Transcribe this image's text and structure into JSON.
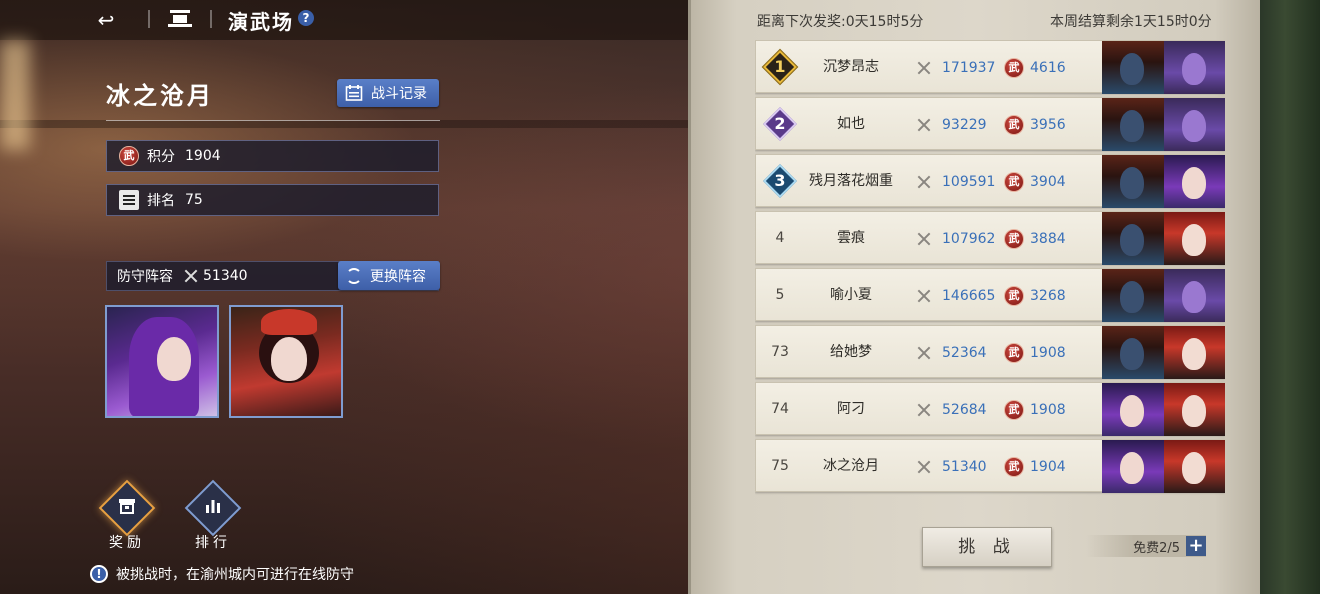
{
  "header": {
    "back_icon": "back-arrow-icon",
    "home_icon": "home-icon",
    "title": "演武场",
    "help_icon": "question-icon",
    "help_glyph": "?"
  },
  "player": {
    "name": "冰之沧月",
    "battle_log_label": "战斗记录",
    "score_label": "积分",
    "score": "1904",
    "rank_label": "排名",
    "rank": "75",
    "defense_label": "防守阵容",
    "defense_power": "51340",
    "change_lineup_label": "更换阵容"
  },
  "side_buttons": {
    "reward_label": "奖励",
    "ranking_label": "排行"
  },
  "tip": {
    "glyph": "!",
    "text": "被挑战时，在渝州城内可进行在线防守"
  },
  "ranking": {
    "reward_timer": "距离下次发奖:0天15时5分",
    "settle_timer": "本周结算剩余1天15时0分",
    "score_badge_glyph": "武",
    "rows": [
      {
        "rank": "1",
        "name": "沉梦昂志",
        "power": "171937",
        "score": "4616",
        "team": [
          "masked",
          "purple-demon"
        ]
      },
      {
        "rank": "2",
        "name": "如也",
        "power": "93229",
        "score": "3956",
        "team": [
          "masked",
          "purple-demon"
        ]
      },
      {
        "rank": "3",
        "name": "残月落花烟重",
        "power": "109591",
        "score": "3904",
        "team": [
          "masked",
          "purple-hair"
        ]
      },
      {
        "rank": "4",
        "name": "雲痕",
        "power": "107962",
        "score": "3884",
        "team": [
          "masked",
          "red-hat"
        ]
      },
      {
        "rank": "5",
        "name": "喻小夏",
        "power": "146665",
        "score": "3268",
        "team": [
          "masked",
          "purple-demon"
        ]
      },
      {
        "rank": "73",
        "name": "给她梦",
        "power": "52364",
        "score": "1908",
        "team": [
          "masked",
          "red-hat"
        ]
      },
      {
        "rank": "74",
        "name": "阿刁",
        "power": "52684",
        "score": "1908",
        "team": [
          "purple-hair",
          "red-hat"
        ]
      },
      {
        "rank": "75",
        "name": "冰之沧月",
        "power": "51340",
        "score": "1904",
        "team": [
          "purple-hair",
          "red-hat"
        ]
      }
    ],
    "challenge_label": "挑 战",
    "free_label": "免费2/5",
    "plus_glyph": "+"
  },
  "colors": {
    "accent_blue": "#3e5fa8",
    "panel_parchment": "#ddd7ca",
    "value_blue": "#3a70b8",
    "gold_rank": "#e8b838"
  }
}
